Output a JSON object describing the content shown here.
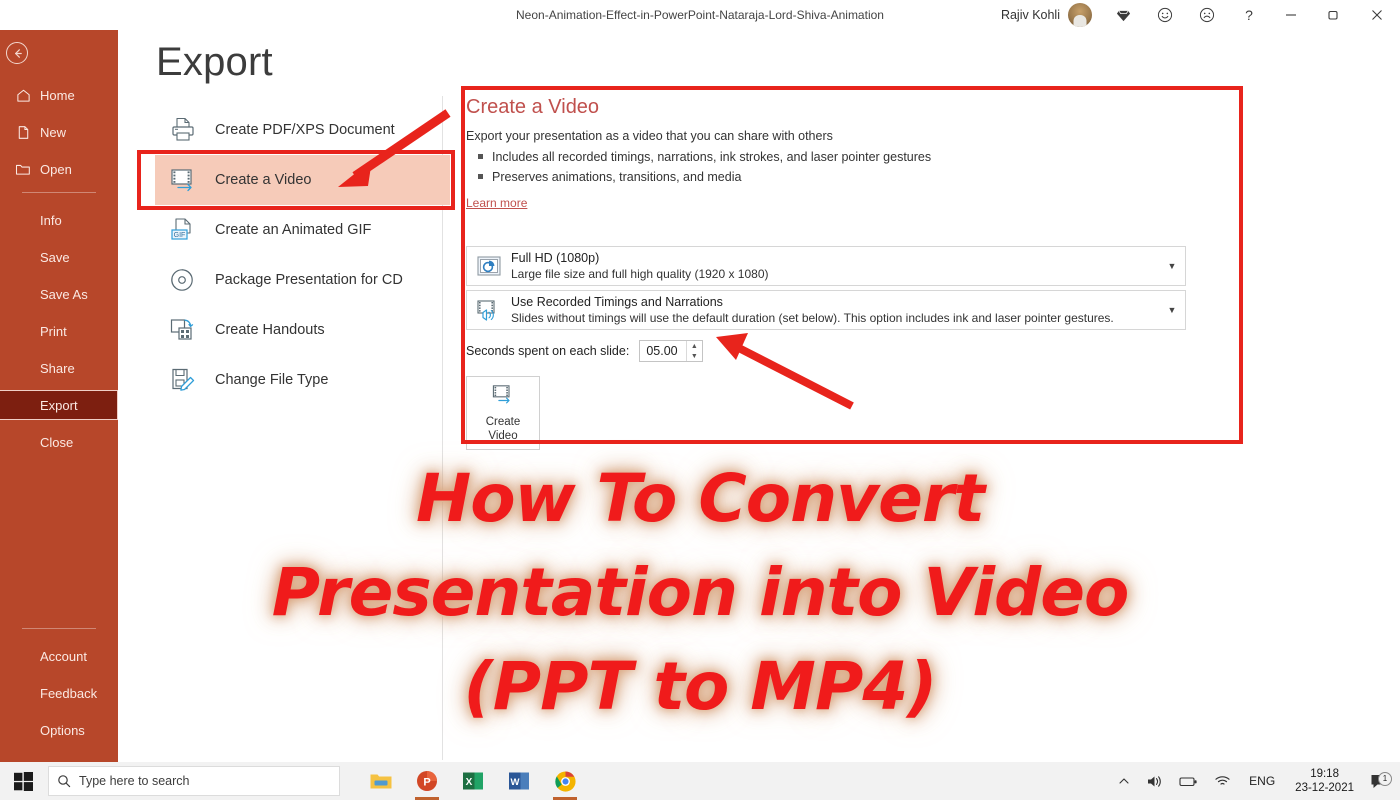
{
  "titlebar": {
    "document_title": "Neon-Animation-Effect-in-PowerPoint-Nataraja-Lord-Shiva-Animation",
    "user_name": "Rajiv Kohli",
    "help_label": "?",
    "icons": [
      "premium-diamond-icon",
      "happy-face-icon",
      "sad-face-icon",
      "help-icon",
      "minimize-icon",
      "restore-icon",
      "close-icon"
    ]
  },
  "sidebar": {
    "back_label": "",
    "top_items": [
      {
        "label": "Home",
        "icon": "home-icon"
      },
      {
        "label": "New",
        "icon": "new-document-icon"
      },
      {
        "label": "Open",
        "icon": "folder-open-icon"
      }
    ],
    "middle_items": [
      {
        "label": "Info"
      },
      {
        "label": "Save"
      },
      {
        "label": "Save As"
      },
      {
        "label": "Print"
      },
      {
        "label": "Share"
      },
      {
        "label": "Export"
      },
      {
        "label": "Close"
      }
    ],
    "active_item": "Export",
    "bottom_items": [
      {
        "label": "Account"
      },
      {
        "label": "Feedback"
      },
      {
        "label": "Options"
      }
    ]
  },
  "main": {
    "page_title": "Export",
    "export_options": [
      {
        "label": "Create PDF/XPS Document",
        "icon": "pdf-printer-icon",
        "selected": false
      },
      {
        "label": "Create a Video",
        "icon": "film-strip-icon",
        "selected": true
      },
      {
        "label": "Create an Animated GIF",
        "icon": "gif-file-icon",
        "selected": false
      },
      {
        "label": "Package Presentation for CD",
        "icon": "cd-disc-icon",
        "selected": false
      },
      {
        "label": "Create Handouts",
        "icon": "handouts-icon",
        "selected": false
      },
      {
        "label": "Change File Type",
        "icon": "file-type-pencil-icon",
        "selected": false
      }
    ]
  },
  "detail": {
    "heading": "Create a Video",
    "subtitle": "Export your presentation as a video that you can share with others",
    "bullets": [
      "Includes all recorded timings, narrations, ink strokes, and laser pointer gestures",
      "Preserves animations, transitions, and media"
    ],
    "learn_more": "Learn more",
    "quality_dropdown": {
      "title": "Full HD (1080p)",
      "description": "Large file size and full high quality (1920 x 1080)",
      "icon": "video-quality-icon"
    },
    "timings_dropdown": {
      "title": "Use Recorded Timings and Narrations",
      "description": "Slides without timings will use the default duration (set below). This option includes ink and laser pointer gestures.",
      "icon": "film-speaker-icon"
    },
    "seconds_label": "Seconds spent on each slide:",
    "seconds_value": "05.00",
    "create_button_line1": "Create",
    "create_button_line2": "Video",
    "create_button_icon": "film-strip-icon"
  },
  "overlay": {
    "line1": "How To Convert",
    "line2": "Presentation into Video",
    "line3": "(PPT to MP4)",
    "text_color": "#f01b1b",
    "glow_color": "#d6a078"
  },
  "taskbar": {
    "search_placeholder": "Type here to search",
    "apps": [
      {
        "name": "file-explorer-icon",
        "open": false
      },
      {
        "name": "powerpoint-icon",
        "open": true
      },
      {
        "name": "excel-icon",
        "open": false
      },
      {
        "name": "word-icon",
        "open": false
      },
      {
        "name": "chrome-icon",
        "open": true
      }
    ],
    "tray": {
      "language": "ENG",
      "time": "19:18",
      "date": "23-12-2021",
      "notification_count": "1"
    }
  },
  "colors": {
    "sidebar": "#b7472a",
    "sidebar_active": "#7d1f10",
    "selected_row": "#f6cbb9",
    "annotation": "#e8241c",
    "accent": "#c0504d"
  }
}
